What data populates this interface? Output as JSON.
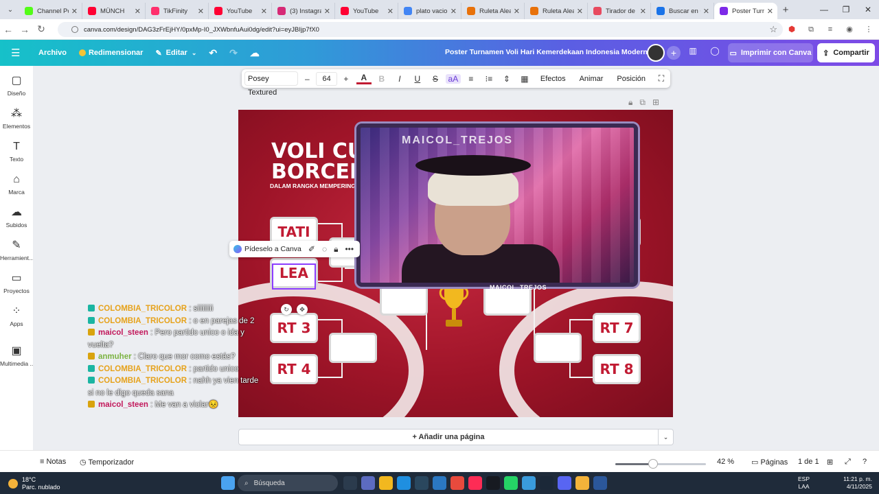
{
  "browser": {
    "tabs": [
      {
        "title": "Channel Poi",
        "color": "#53fc18"
      },
      {
        "title": "MÜNCH",
        "color": "#ff0033"
      },
      {
        "title": "TikFinity",
        "color": "#ff2f6d"
      },
      {
        "title": "YouTube",
        "color": "#ff0033"
      },
      {
        "title": "(3) Instagram",
        "color": "#d62976"
      },
      {
        "title": "YouTube",
        "color": "#ff0033"
      },
      {
        "title": "plato vacio",
        "color": "#4285f4"
      },
      {
        "title": "Ruleta Aleat",
        "color": "#e8710a"
      },
      {
        "title": "Ruleta Aleat",
        "color": "#e8710a"
      },
      {
        "title": "Tirador de d",
        "color": "#e84a5f"
      },
      {
        "title": "Buscar en C",
        "color": "#1a73e8"
      },
      {
        "title": "Poster Turna",
        "color": "#7d2ae8"
      }
    ],
    "url": "canva.com/design/DAG3zFrEjHY/0pxMp-I0_JXWbnfuAui0dg/edit?ui=eyJBIjp7fX0"
  },
  "header": {
    "menu_file": "Archivo",
    "resize": "Redimensionar",
    "edit": "Editar",
    "doc_title": "Poster Turnamen Voli Hari Kemerdekaan Indonesia Modern ...",
    "print": "Imprimir con Canva",
    "share": "Compartir"
  },
  "sidebar": [
    {
      "label": "Diseño",
      "icon": "layout-icon",
      "glyph": "▢"
    },
    {
      "label": "Elementos",
      "icon": "elements-icon",
      "glyph": "⁂"
    },
    {
      "label": "Texto",
      "icon": "text-icon",
      "glyph": "T"
    },
    {
      "label": "Marca",
      "icon": "brand-icon",
      "glyph": "⌂"
    },
    {
      "label": "Subidos",
      "icon": "upload-icon",
      "glyph": "☁"
    },
    {
      "label": "Herramient...",
      "icon": "tools-icon",
      "glyph": "✎"
    },
    {
      "label": "Proyectos",
      "icon": "folder-icon",
      "glyph": "▭"
    },
    {
      "label": "Apps",
      "icon": "apps-icon",
      "glyph": "⁘"
    },
    {
      "label": "Multimedia ...",
      "icon": "media-icon",
      "glyph": "▣"
    }
  ],
  "toolbar": {
    "font": "Posey Textured",
    "size": "64",
    "effects": "Efectos",
    "animate": "Animar",
    "position": "Posición"
  },
  "poster": {
    "title_line1": "VOLI CUP",
    "title_line2": "BORCELLE",
    "subtitle": "DALAM RANGKA MEMPERINGA",
    "team1": "TATI",
    "team2": "LEA",
    "team3": "RT 3",
    "team4": "RT 4",
    "team7": "RT 7",
    "team8": "RT 8",
    "webcam_name": "MAICOL_TREJOS",
    "webcam_sign": "MAICOL_TREJOS"
  },
  "float_menu": {
    "ask": "Pídeselo a Canva"
  },
  "chat": [
    {
      "user": "COLOMBIA_TRICOLOR",
      "msg": "siiiiiiiii",
      "color": "#e6a21b"
    },
    {
      "user": "COLOMBIA_TRICOLOR",
      "msg": "o en parejas de 2",
      "color": "#e6a21b"
    },
    {
      "user": "maicol_steen",
      "msg": "Pero partido unico o ida y vuelta?",
      "color": "#c2185b"
    },
    {
      "user": "anmuher",
      "msg": "Claro que mor como estás?",
      "color": "#7cb342"
    },
    {
      "user": "COLOMBIA_TRICOLOR",
      "msg": "partido unico",
      "color": "#e6a21b"
    },
    {
      "user": "COLOMBIA_TRICOLOR",
      "msg": "nahh ya vien tarde si no le digo queda sana",
      "color": "#e6a21b"
    },
    {
      "user": "maicol_steen",
      "msg": "Me van a violar😣",
      "color": "#c2185b"
    }
  ],
  "footer": {
    "add_page": "+ Añadir una página",
    "notes": "Notas",
    "timer": "Temporizador",
    "zoom": "42 %",
    "zoom_level": 0.42,
    "pages": "Páginas",
    "page_count": "1 de 1"
  },
  "taskbar": {
    "temp": "18°C",
    "weather": "Parc. nublado",
    "search": "Búsqueda",
    "lang1": "ESP",
    "lang2": "LAA",
    "time": "11:21 p. m.",
    "date": "4/11/2025"
  }
}
